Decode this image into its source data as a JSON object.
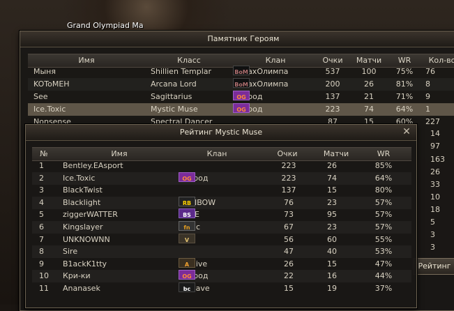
{
  "scene": {
    "top_label": "Grand Olympiad Ma"
  },
  "heroes": {
    "title": "Памятник Героям",
    "columns": [
      "Имя",
      "Класс",
      "Клан",
      "Очки",
      "Матчи",
      "WR",
      "Кол-во"
    ],
    "rows": [
      {
        "name": "Мыня",
        "class": "Shillien Templar",
        "clan_icon": "bom-icon",
        "clan_icon_text": "BoM",
        "clan": "СтрахОлимпа",
        "points": "537",
        "matches": "100",
        "wr": "75%",
        "count": "76"
      },
      {
        "name": "KOToMEH",
        "class": "Arcana Lord",
        "clan_icon": "bom-icon",
        "clan_icon_text": "BoM",
        "clan": "СтрахОлимпа",
        "points": "200",
        "matches": "26",
        "wr": "81%",
        "count": "8"
      },
      {
        "name": "See",
        "class": "Sagittarius",
        "clan_icon": "og-icon",
        "clan_icon_text": "OG",
        "clan": "Огород",
        "points": "137",
        "matches": "21",
        "wr": "71%",
        "count": "9"
      },
      {
        "name": "Ice.Toxic",
        "class": "Mystic Muse",
        "clan_icon": "og-icon",
        "clan_icon_text": "OG",
        "clan": "Огород",
        "points": "223",
        "matches": "74",
        "wr": "64%",
        "count": "1"
      },
      {
        "name": "Nonsense",
        "class": "Spectral Dancer",
        "clan_icon": "og-icon",
        "clan_icon_text": "OG",
        "clan": "",
        "points": "87",
        "matches": "15",
        "wr": "60%",
        "count": "227"
      }
    ],
    "extra_counts": [
      "14",
      "97",
      "163",
      "26",
      "33",
      "10",
      "18",
      "5",
      "3",
      "3"
    ]
  },
  "rating": {
    "title": "Рейтинг Mystic Muse",
    "columns": [
      "№",
      "Имя",
      "Клан",
      "Очки",
      "Матчи",
      "WR"
    ],
    "rows": [
      {
        "n": "1",
        "name": "Bentley.EAsport",
        "clan_icon": "",
        "clan_icon_text": "",
        "clan": "",
        "points": "223",
        "matches": "26",
        "wr": "85%"
      },
      {
        "n": "2",
        "name": "Ice.Toxic",
        "clan_icon": "og-icon",
        "clan_icon_text": "OG",
        "clan": "Огород",
        "points": "223",
        "matches": "74",
        "wr": "64%"
      },
      {
        "n": "3",
        "name": "BlackTwist",
        "clan_icon": "",
        "clan_icon_text": "",
        "clan": "",
        "points": "137",
        "matches": "15",
        "wr": "80%"
      },
      {
        "n": "4",
        "name": "Blacklight",
        "clan_icon": "rainbow-icon",
        "clan_icon_text": "RB",
        "clan": "RAINBOW",
        "points": "76",
        "matches": "23",
        "wr": "57%"
      },
      {
        "n": "5",
        "name": "ziggerWATTER",
        "clan_icon": "bsoe-icon",
        "clan_icon_text": "BS",
        "clan": "BSOE",
        "points": "73",
        "matches": "95",
        "wr": "57%"
      },
      {
        "n": "6",
        "name": "Kingslayer",
        "clan_icon": "fnatic-icon",
        "clan_icon_text": "fn",
        "clan": "fnatic",
        "points": "67",
        "matches": "23",
        "wr": "57%"
      },
      {
        "n": "7",
        "name": "UNKNOWNN",
        "clan_icon": "vex-icon",
        "clan_icon_text": "V",
        "clan": "Vex",
        "points": "56",
        "matches": "60",
        "wr": "55%"
      },
      {
        "n": "8",
        "name": "Sire",
        "clan_icon": "",
        "clan_icon_text": "",
        "clan": "",
        "points": "47",
        "matches": "40",
        "wr": "53%"
      },
      {
        "n": "9",
        "name": "B1ackK1tty",
        "clan_icon": "archive-icon",
        "clan_icon_text": "A",
        "clan": "Archive",
        "points": "26",
        "matches": "15",
        "wr": "47%"
      },
      {
        "n": "10",
        "name": "Кри-ки",
        "clan_icon": "og-icon",
        "clan_icon_text": "OG",
        "clan": "Огород",
        "points": "22",
        "matches": "16",
        "wr": "44%"
      },
      {
        "n": "11",
        "name": "Ananasek",
        "clan_icon": "batcave-icon",
        "clan_icon_text": "bc",
        "clan": "Batcave",
        "points": "15",
        "matches": "19",
        "wr": "37%"
      }
    ],
    "button_label": "Рейтинг"
  }
}
